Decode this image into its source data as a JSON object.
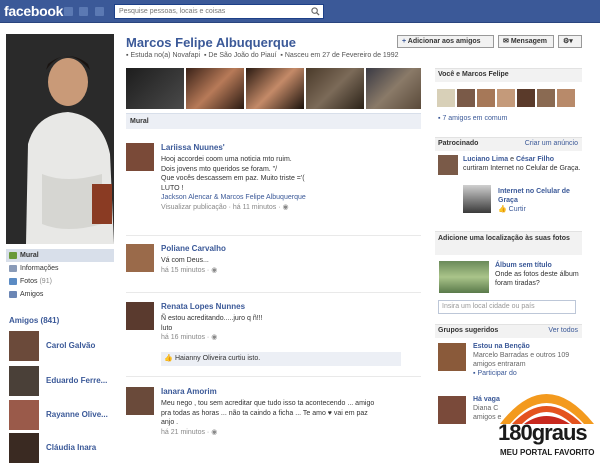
{
  "topbar": {
    "logo": "facebook",
    "search_placeholder": "Pesquise pessoas, locais e coisas"
  },
  "profile": {
    "name": "Marcos Felipe Albuquerque",
    "studied": "Estuda no(a) Novafapi",
    "from": "De São João do Piauí",
    "born": "Nasceu em 27 de Fevereiro de 1992",
    "add_friend": "Adicionar aos amigos",
    "message": "Mensagem"
  },
  "leftnav": {
    "items": [
      "Mural",
      "Informações",
      "Fotos",
      "Amigos"
    ],
    "photos_count": "(91)"
  },
  "friends": {
    "header": "Amigos (841)",
    "list": [
      "Carol Galvão",
      "Eduardo Ferre...",
      "Rayanne Olive...",
      "Cláudia Inara"
    ]
  },
  "wall": {
    "header": "Mural",
    "posts": [
      {
        "author": "Lariissa Nuunes'",
        "lines": [
          "Hooj accordei coom uma noticia mto ruim.",
          "Dois jovens mto queridos se foram. \"/",
          "Que vocês descassem em paz. Muito triste ='(",
          "LUTO !"
        ],
        "tags": "Jackson Alencar & Marcos Felipe Albuquerque",
        "footer": "Visualizar publicação · há 11 minutos ·"
      },
      {
        "author": "Poliane Carvalho",
        "lines": [
          "Vá com Deus..."
        ],
        "footer": "há 15 minutos ·"
      },
      {
        "author": "Renata Lopes Nunnes",
        "lines": [
          "Ñ estou acreditando.....juro q ñ!!!",
          "luto"
        ],
        "footer": "há 16 minutos ·",
        "like": "Haianny Oliveira curtiu isto."
      },
      {
        "author": "Ianara Amorim",
        "lines": [
          "Meu nego , tou sem acreditar que tudo isso ta acontecendo ... amigo",
          "pra todas as horas ... não ta caindo a ficha ... Te amo ♥ vai em paz",
          "anjo ."
        ],
        "footer": "há 21 minutos ·"
      }
    ]
  },
  "right": {
    "mutual_hd": "Você e Marcos Felipe",
    "mutual_count": "7 amigos em comum",
    "sponsored_hd": "Patrocinado",
    "create_ad": "Criar um anúncio",
    "ad1_a": "Luciano Lima",
    "ad1_b": "e",
    "ad1_c": "César Filho",
    "ad1_d": "curtiram Internet no Celular de Graça.",
    "ad2_title": "Internet no Celular de Graça",
    "ad2_like": "Curtir",
    "location_hd": "Adicione uma localização às suas fotos",
    "album_title": "Álbum sem título",
    "album_q": "Onde as fotos deste álbum foram tiradas?",
    "location_placeholder": "Insira um local cidade ou país",
    "groups_hd": "Grupos sugeridos",
    "groups_all": "Ver todos",
    "group1": "Estou na Benção",
    "group1_sub": "Marcelo Barradas e outros 109 amigos entraram",
    "group1_join": "Participar do",
    "group2": "Há vaga",
    "group2_sub": "Diana C",
    "group2_sub2": "amigos e"
  },
  "watermark": {
    "brand": "180graus",
    "tagline": "MEU PORTAL FAVORITO"
  }
}
